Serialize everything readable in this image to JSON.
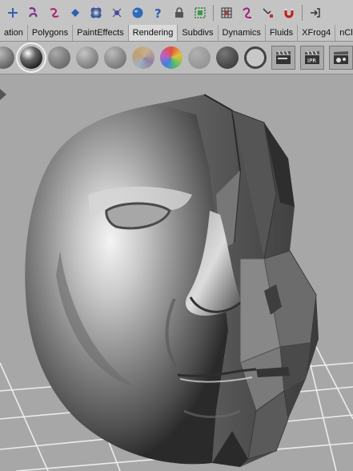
{
  "toolbar": {
    "icons": [
      "plus-icon",
      "lasso-icon",
      "curve-icon",
      "paint-icon",
      "graph-icon",
      "bug-icon",
      "sphere-icon",
      "help-icon",
      "lock-icon",
      "select-icon",
      "grid-icon",
      "knot-icon",
      "magnet-curve-icon",
      "magnet-icon",
      "export-icon"
    ]
  },
  "shelf": {
    "tabs": [
      "ation",
      "Polygons",
      "PaintEffects",
      "Rendering",
      "Subdivs",
      "Dynamics",
      "Fluids",
      "XFrog4",
      "nCloth"
    ],
    "active_tab": "Rendering",
    "swatch_colors": [
      "#777777",
      "#3c3c3c",
      "#8a8a8a",
      "#9c9c9c",
      "#8f8f8f",
      "#b0a090",
      "#d07060",
      "#9e9e9e",
      "#555555",
      "#dcdcdc"
    ],
    "render_button_icons": [
      "clapper-icon",
      "ipr-clapper-icon",
      "render-settings-icon",
      "teapot-icon"
    ],
    "ipr_label": "IPR"
  },
  "viewport": {
    "background": "#a7a7a7",
    "grid_color": "#e8e8e8"
  }
}
